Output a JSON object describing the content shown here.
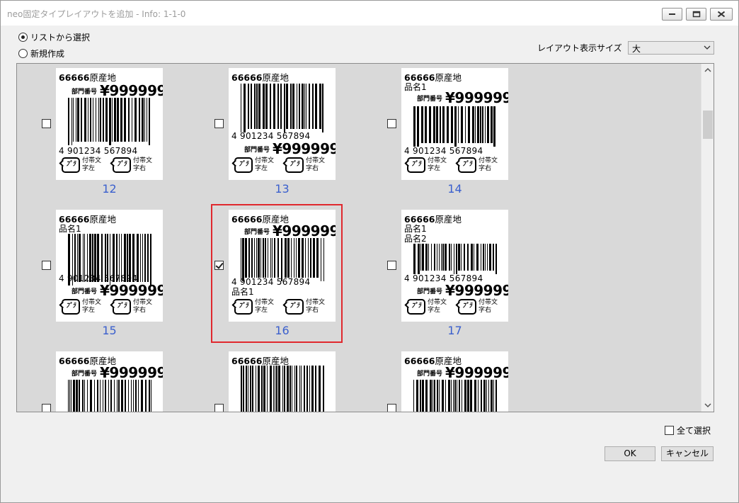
{
  "window": {
    "title": "neo固定タイプレイアウトを追加 - Info: 1-1-0"
  },
  "source_options": [
    {
      "label": "リストから選択",
      "selected": true
    },
    {
      "label": "新規作成",
      "selected": false
    }
  ],
  "layout_size": {
    "label": "レイアウト表示サイズ",
    "value": "大"
  },
  "label_text": {
    "origin": "66666原産地",
    "origin_num": "66666",
    "origin_word": "原産地",
    "dept": "部門番号",
    "price": "¥999999",
    "name1": "品名1",
    "name2": "品名2",
    "jan": "4  901234  567894",
    "recycle_mark": "ﾌﾟﾗ",
    "recycle_left": "付帯文\n字左",
    "recycle_right": "付帯文\n字右",
    "rl1": "付帯文",
    "rl2": "字左",
    "rr1": "付帯文",
    "rr2": "字右"
  },
  "layouts": [
    {
      "number": "12",
      "checked": false
    },
    {
      "number": "13",
      "checked": false
    },
    {
      "number": "14",
      "checked": false
    },
    {
      "number": "15",
      "checked": false
    },
    {
      "number": "16",
      "checked": true
    },
    {
      "number": "17",
      "checked": false
    },
    {
      "number": "",
      "checked": false
    },
    {
      "number": "",
      "checked": false
    },
    {
      "number": "",
      "checked": false
    }
  ],
  "footer": {
    "select_all_label": "全て選択",
    "ok_label": "OK",
    "cancel_label": "キャンセル"
  }
}
